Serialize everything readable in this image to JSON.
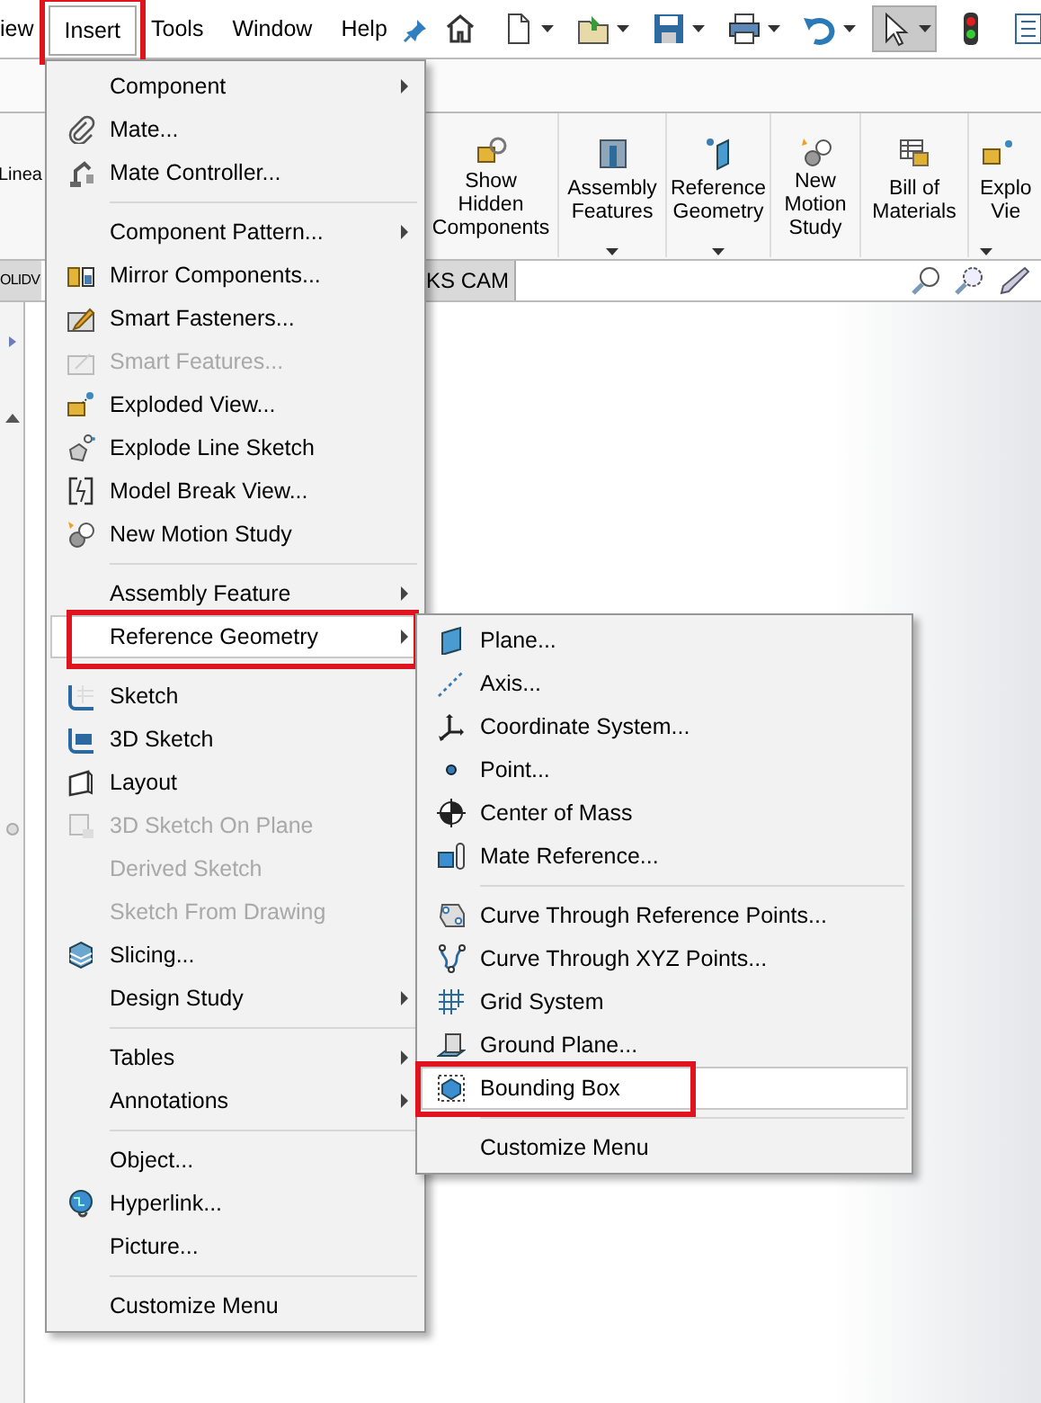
{
  "menubar": [
    {
      "label": "iew",
      "selected": false,
      "annotated": false
    },
    {
      "label": "Insert",
      "selected": true,
      "annotated": true
    },
    {
      "label": "Tools",
      "selected": false,
      "annotated": false
    },
    {
      "label": "Window",
      "selected": false,
      "annotated": false
    },
    {
      "label": "Help",
      "selected": false,
      "annotated": false
    }
  ],
  "toolbar": [
    {
      "selected": false,
      "has_dropdown": false
    },
    {
      "selected": false,
      "has_dropdown": true
    },
    {
      "selected": false,
      "has_dropdown": true
    },
    {
      "selected": false,
      "has_dropdown": true
    },
    {
      "selected": false,
      "has_dropdown": true
    },
    {
      "selected": false,
      "has_dropdown": true
    },
    {
      "selected": true,
      "has_dropdown": true
    },
    {
      "selected": false,
      "has_dropdown": false
    },
    {
      "selected": false,
      "has_dropdown": false
    }
  ],
  "ribbon": {
    "cut_label": "Linea",
    "buttons": [
      {
        "lines": [
          "Show",
          "Hidden",
          "Components"
        ],
        "has_dropdown": false
      },
      {
        "lines": [
          "Assembly",
          "Features"
        ],
        "has_dropdown": true
      },
      {
        "lines": [
          "Reference",
          "Geometry"
        ],
        "has_dropdown": true
      },
      {
        "lines": [
          "New",
          "Motion",
          "Study"
        ],
        "has_dropdown": false
      },
      {
        "lines": [
          "Bill of",
          "Materials"
        ],
        "has_dropdown": false
      },
      {
        "lines": [
          "Explo",
          "Vie"
        ],
        "has_dropdown": true
      }
    ]
  },
  "tabs": [
    {
      "label": "OLIDV",
      "selected": false
    },
    {
      "label": "KS CAM",
      "selected": false
    }
  ],
  "insert_menu": {
    "sections": [
      [
        {
          "label": "Component",
          "disabled": false,
          "has_submenu": true,
          "selected": false,
          "annotated": false
        },
        {
          "label": "Mate...",
          "disabled": false,
          "has_submenu": false,
          "selected": false,
          "annotated": false
        },
        {
          "label": "Mate Controller...",
          "disabled": false,
          "has_submenu": false,
          "selected": false,
          "annotated": false
        }
      ],
      [
        {
          "label": "Component Pattern...",
          "disabled": false,
          "has_submenu": true,
          "selected": false,
          "annotated": false
        },
        {
          "label": "Mirror Components...",
          "disabled": false,
          "has_submenu": false,
          "selected": false,
          "annotated": false
        },
        {
          "label": "Smart Fasteners...",
          "disabled": false,
          "has_submenu": false,
          "selected": false,
          "annotated": false
        },
        {
          "label": "Smart Features...",
          "disabled": true,
          "has_submenu": false,
          "selected": false,
          "annotated": false
        },
        {
          "label": "Exploded View...",
          "disabled": false,
          "has_submenu": false,
          "selected": false,
          "annotated": false
        },
        {
          "label": "Explode Line Sketch",
          "disabled": false,
          "has_submenu": false,
          "selected": false,
          "annotated": false
        },
        {
          "label": "Model Break View...",
          "disabled": false,
          "has_submenu": false,
          "selected": false,
          "annotated": false
        },
        {
          "label": "New Motion Study",
          "disabled": false,
          "has_submenu": false,
          "selected": false,
          "annotated": false
        }
      ],
      [
        {
          "label": "Assembly Feature",
          "disabled": false,
          "has_submenu": true,
          "selected": false,
          "annotated": false
        },
        {
          "label": "Reference Geometry",
          "disabled": false,
          "has_submenu": true,
          "selected": true,
          "annotated": true
        }
      ],
      [
        {
          "label": "Sketch",
          "disabled": false,
          "has_submenu": false,
          "selected": false,
          "annotated": false
        },
        {
          "label": "3D Sketch",
          "disabled": false,
          "has_submenu": false,
          "selected": false,
          "annotated": false
        },
        {
          "label": "Layout",
          "disabled": false,
          "has_submenu": false,
          "selected": false,
          "annotated": false
        },
        {
          "label": "3D Sketch On Plane",
          "disabled": true,
          "has_submenu": false,
          "selected": false,
          "annotated": false
        },
        {
          "label": "Derived Sketch",
          "disabled": true,
          "has_submenu": false,
          "selected": false,
          "annotated": false
        },
        {
          "label": "Sketch From Drawing",
          "disabled": true,
          "has_submenu": false,
          "selected": false,
          "annotated": false
        },
        {
          "label": "Slicing...",
          "disabled": false,
          "has_submenu": false,
          "selected": false,
          "annotated": false
        },
        {
          "label": "Design Study",
          "disabled": false,
          "has_submenu": true,
          "selected": false,
          "annotated": false
        }
      ],
      [
        {
          "label": "Tables",
          "disabled": false,
          "has_submenu": true,
          "selected": false,
          "annotated": false
        },
        {
          "label": "Annotations",
          "disabled": false,
          "has_submenu": true,
          "selected": false,
          "annotated": false
        }
      ],
      [
        {
          "label": "Object...",
          "disabled": false,
          "has_submenu": false,
          "selected": false,
          "annotated": false
        },
        {
          "label": "Hyperlink...",
          "disabled": false,
          "has_submenu": false,
          "selected": false,
          "annotated": false
        },
        {
          "label": "Picture...",
          "disabled": false,
          "has_submenu": false,
          "selected": false,
          "annotated": false
        }
      ],
      [
        {
          "label": "Customize Menu",
          "disabled": false,
          "has_submenu": false,
          "selected": false,
          "annotated": false
        }
      ]
    ]
  },
  "reference_geometry_submenu": {
    "sections": [
      [
        {
          "label": "Plane...",
          "selected": false,
          "annotated": false
        },
        {
          "label": "Axis...",
          "selected": false,
          "annotated": false
        },
        {
          "label": "Coordinate System...",
          "selected": false,
          "annotated": false
        },
        {
          "label": "Point...",
          "selected": false,
          "annotated": false
        },
        {
          "label": "Center of Mass",
          "selected": false,
          "annotated": false
        },
        {
          "label": "Mate Reference...",
          "selected": false,
          "annotated": false
        }
      ],
      [
        {
          "label": "Curve Through Reference Points...",
          "selected": false,
          "annotated": false
        },
        {
          "label": "Curve Through XYZ Points...",
          "selected": false,
          "annotated": false
        },
        {
          "label": "Grid System",
          "selected": false,
          "annotated": false
        },
        {
          "label": "Ground Plane...",
          "selected": false,
          "annotated": false
        },
        {
          "label": "Bounding Box",
          "selected": true,
          "annotated": true
        }
      ],
      [
        {
          "label": "Customize Menu",
          "selected": false,
          "annotated": false
        }
      ]
    ]
  }
}
